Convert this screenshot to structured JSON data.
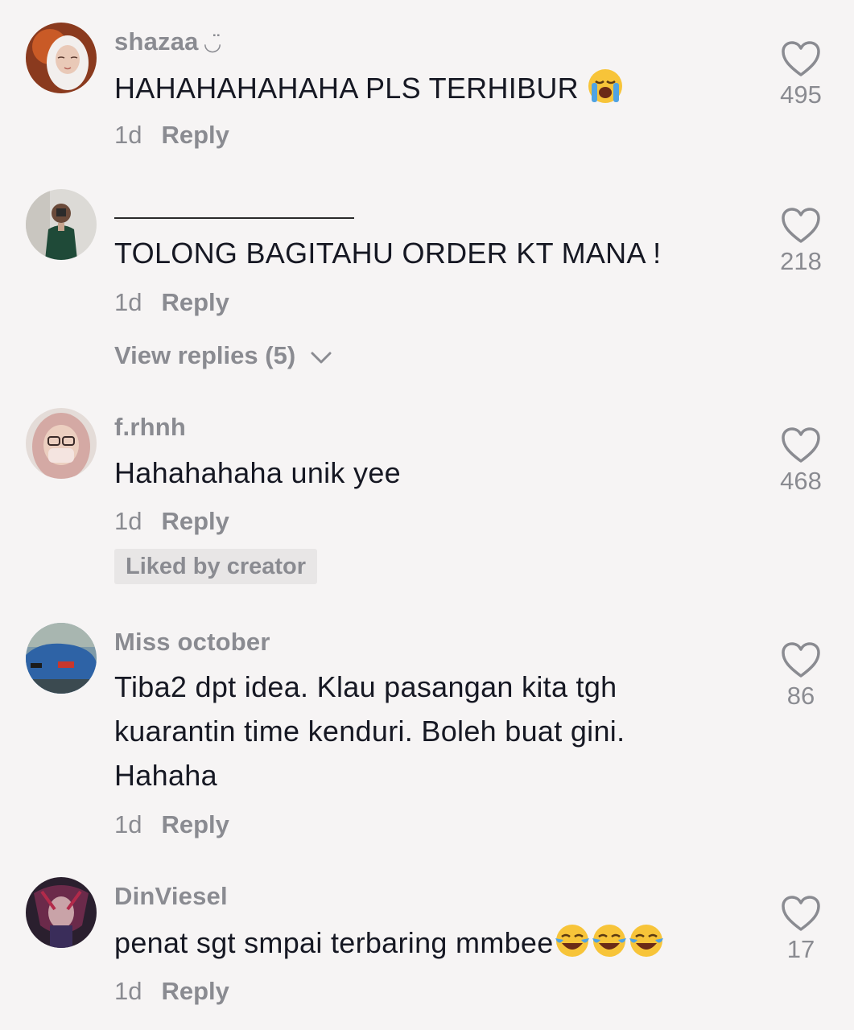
{
  "comments": [
    {
      "username": "shazaa",
      "username_suffix": "◡̈",
      "text": "HAHAHAHAHAHA PLS TERHIBUR",
      "emoji": "loudly-crying-face",
      "time": "1d",
      "reply_label": "Reply",
      "likes": "495"
    },
    {
      "username": "",
      "text": "TOLONG BAGITAHU ORDER KT MANA !",
      "time": "1d",
      "reply_label": "Reply",
      "likes": "218",
      "view_replies": "View replies (5)"
    },
    {
      "username": "f.rhnh",
      "text": "Hahahahaha unik yee",
      "time": "1d",
      "reply_label": "Reply",
      "likes": "468",
      "badge": "Liked by creator"
    },
    {
      "username": "Miss october",
      "text_lines": [
        "Tiba2 dpt idea. Klau pasangan kita tgh",
        "kuarantin time kenduri. Boleh buat gini.",
        "Hahaha"
      ],
      "time": "1d",
      "reply_label": "Reply",
      "likes": "86"
    },
    {
      "username": "DinViesel",
      "text": "penat sgt smpai terbaring mmbee",
      "emoji": "face-with-tears-of-joy",
      "time": "1d",
      "reply_label": "Reply",
      "likes": "17"
    }
  ],
  "colors": {
    "background": "#f6f4f4",
    "text": "#161823",
    "muted": "#8a8b91"
  }
}
